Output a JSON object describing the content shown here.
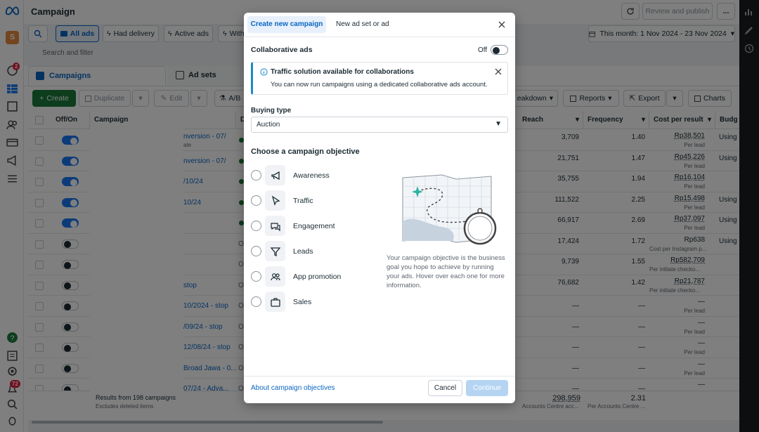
{
  "topbar": {
    "title": "Campaigns",
    "review_publish": "Review and publish",
    "more": "..."
  },
  "filters": {
    "all_ads": "All ads",
    "had_delivery": "Had delivery",
    "active_ads": "Active ads",
    "with": "With",
    "date_range": "This month: 1 Nov 2024 - 23 Nov 2024",
    "search_placeholder": "Search and filter"
  },
  "tabs": {
    "campaigns": "Campaigns",
    "ad_sets": "Ad sets"
  },
  "toolbar": {
    "create": "Create",
    "duplicate": "Duplicate",
    "edit": "Edit",
    "ab": "A/B",
    "breakdown": "eakdown",
    "reports": "Reports",
    "export": "Export",
    "charts": "Charts"
  },
  "table": {
    "headers": {
      "offon": "Off/On",
      "campaign": "Campaign",
      "d": "D",
      "reach": "Reach",
      "frequency": "Frequency",
      "cost_per_result": "Cost per result",
      "budget": "Budg"
    },
    "rows": [
      {
        "on": true,
        "name": "nversion - 07/",
        "sub": "ate",
        "reach": "3,709",
        "freq": "1.40",
        "cost": "Rp38,501",
        "cost_sub": "Per lead",
        "budget": "Using",
        "status": "dot"
      },
      {
        "on": true,
        "name": "nversion - 07/",
        "sub": "",
        "reach": "21,751",
        "freq": "1.47",
        "cost": "Rp45,226",
        "cost_sub": "Per lead",
        "budget": "Using",
        "status": "dot"
      },
      {
        "on": true,
        "name": "/10/24",
        "sub": "",
        "reach": "35,755",
        "freq": "1.94",
        "cost": "Rp16,104",
        "cost_sub": "Per lead",
        "budget": "",
        "status": "dot"
      },
      {
        "on": true,
        "name": "10/24",
        "sub": "",
        "reach": "111,522",
        "freq": "2.25",
        "cost": "Rp15,498",
        "cost_sub": "Per lead",
        "budget": "Using",
        "status": "dot"
      },
      {
        "on": true,
        "name": "",
        "sub": "",
        "reach": "66,917",
        "freq": "2.69",
        "cost": "Rp37,097",
        "cost_sub": "Per lead",
        "budget": "Using",
        "status": "dot"
      },
      {
        "on": false,
        "name": "",
        "sub": "",
        "reach": "17,424",
        "freq": "1.72",
        "cost": "Rp638",
        "cost_sub": "Cost per Instagram p...",
        "budget": "Using",
        "status": "O"
      },
      {
        "on": false,
        "name": "",
        "sub": "",
        "reach": "9,739",
        "freq": "1.55",
        "cost": "Rp582,709",
        "cost_sub": "Per initiate checko...",
        "budget": "",
        "status": "O"
      },
      {
        "on": false,
        "name": "stop",
        "sub": "",
        "reach": "76,682",
        "freq": "1.42",
        "cost": "Rp21,787",
        "cost_sub": "Per initiate checko...",
        "budget": "",
        "status": "O"
      },
      {
        "on": false,
        "name": "10/2024 - stop",
        "sub": "",
        "reach": "—",
        "freq": "—",
        "cost": "—",
        "cost_sub": "Per lead",
        "budget": "",
        "status": "O"
      },
      {
        "on": false,
        "name": "/09/24 - stop",
        "sub": "",
        "reach": "—",
        "freq": "—",
        "cost": "—",
        "cost_sub": "Per lead",
        "budget": "",
        "status": "O"
      },
      {
        "on": false,
        "name": "12/08/24 - stop",
        "sub": "",
        "reach": "—",
        "freq": "—",
        "cost": "—",
        "cost_sub": "Per lead",
        "budget": "",
        "status": "O"
      },
      {
        "on": false,
        "name": "Broad Jawa - 0...",
        "sub": "",
        "reach": "—",
        "freq": "—",
        "cost": "—",
        "cost_sub": "Per lead",
        "budget": "",
        "status": "O"
      },
      {
        "on": false,
        "name": "07/24 - Adva...",
        "sub": "",
        "reach": "—",
        "freq": "—",
        "cost": "—",
        "cost_sub": "",
        "budget": "",
        "status": "O"
      }
    ],
    "footer": {
      "results": "Results from 198 campaigns",
      "excludes": "Excludes deleted items",
      "reach": "298,959",
      "reach_sub": "Accounts Centre acc...",
      "freq": "2.31",
      "freq_sub": "Per Accounts Centre ..."
    }
  },
  "rail": {
    "avatar": "S",
    "badge_notifications": "2",
    "badge_bottom": "72"
  },
  "modal": {
    "tab_create": "Create new campaign",
    "tab_new": "New ad set or ad",
    "collab_label": "Collaborative ads",
    "collab_state": "Off",
    "banner_title": "Traffic solution available for collaborations",
    "banner_body": "You can now run campaigns using a dedicated collaborative ads account.",
    "buying_type_label": "Buying type",
    "buying_type_value": "Auction",
    "objective_heading": "Choose a campaign objective",
    "objectives": [
      {
        "label": "Awareness",
        "icon": "megaphone-icon"
      },
      {
        "label": "Traffic",
        "icon": "cursor-icon"
      },
      {
        "label": "Engagement",
        "icon": "chat-icon"
      },
      {
        "label": "Leads",
        "icon": "funnel-icon"
      },
      {
        "label": "App promotion",
        "icon": "people-icon"
      },
      {
        "label": "Sales",
        "icon": "briefcase-icon"
      }
    ],
    "description": "Your campaign objective is the business goal you hope to achieve by running your ads. Hover over each one for more information.",
    "about_link": "About campaign objectives",
    "cancel": "Cancel",
    "continue": "Continue"
  },
  "colors": {
    "accent": "#0a66c2",
    "create_green": "#1b7a3a",
    "toggle_on": "#1877f2",
    "banner_border": "#1e88c9"
  }
}
